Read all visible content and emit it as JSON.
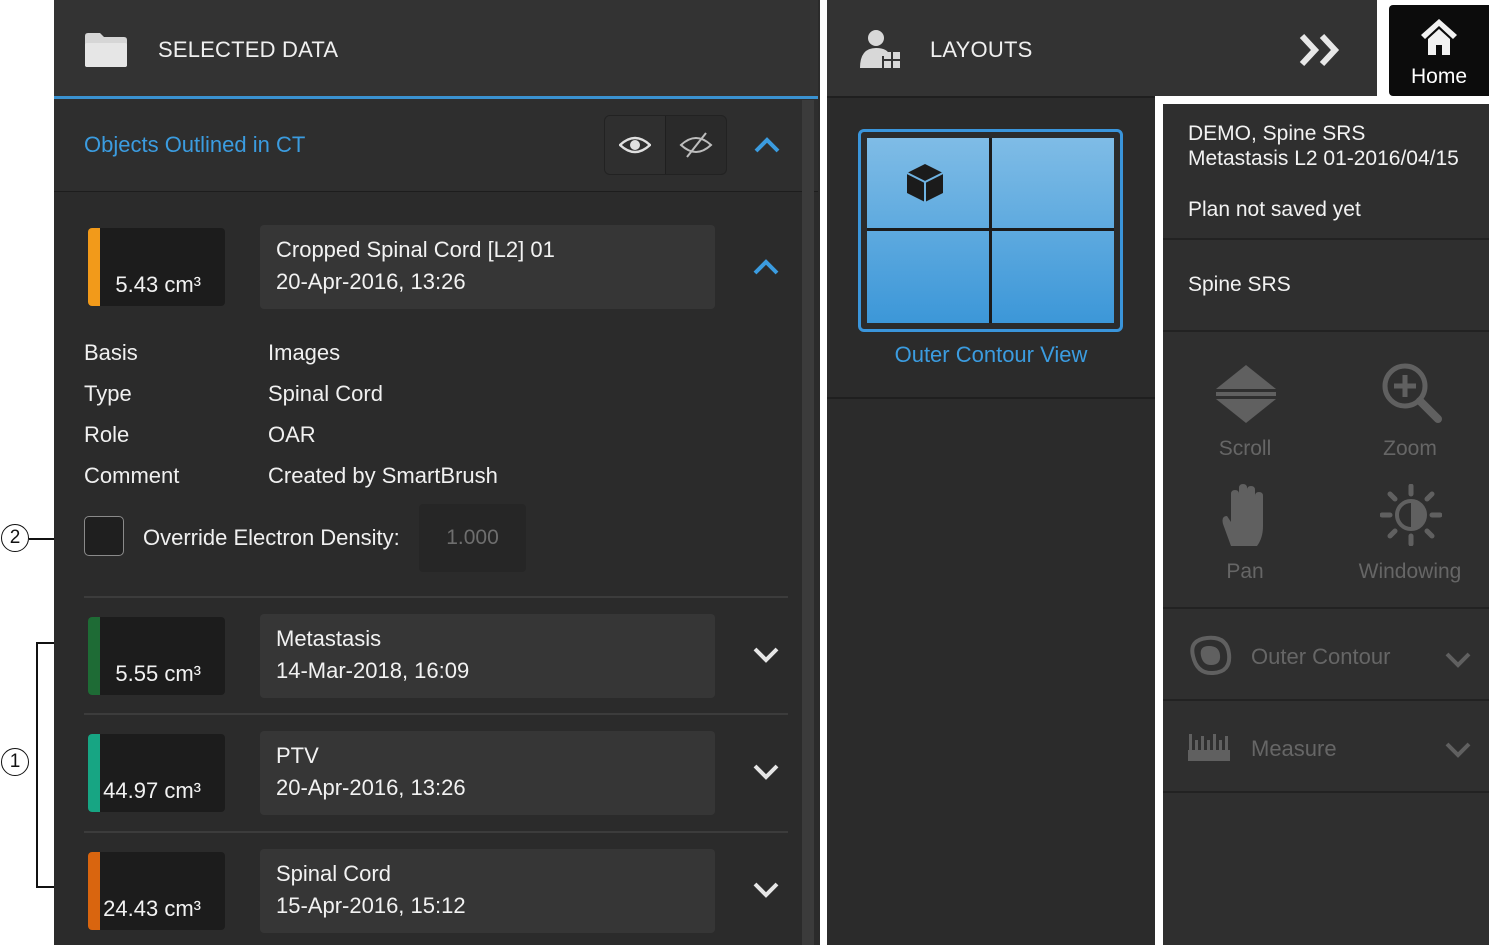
{
  "callouts": {
    "two": "2",
    "one": "1"
  },
  "selected_data": {
    "header_title": "SELECTED DATA",
    "section_title": "Objects Outlined in CT",
    "expanded_object": {
      "volume": "5.43 cm³",
      "color": "#f29a1a",
      "name": "Cropped Spinal Cord [L2] 01",
      "date": "20-Apr-2016, 13:26",
      "properties": [
        {
          "label": "Basis",
          "value": "Images"
        },
        {
          "label": "Type",
          "value": "Spinal Cord"
        },
        {
          "label": "Role",
          "value": "OAR"
        },
        {
          "label": "Comment",
          "value": "Created by SmartBrush"
        }
      ],
      "override_label": "Override Electron Density:",
      "override_value": "1.000"
    },
    "objects": [
      {
        "volume": "5.55 cm³",
        "color": "#1e6b35",
        "name": "Metastasis",
        "date": "14-Mar-2018, 16:09"
      },
      {
        "volume": "44.97 cm³",
        "color": "#17a583",
        "name": "PTV",
        "date": "20-Apr-2016, 13:26"
      },
      {
        "volume": "24.43 cm³",
        "color": "#d9650f",
        "name": "Spinal Cord",
        "date": "15-Apr-2016, 15:12"
      }
    ]
  },
  "layouts": {
    "header_title": "LAYOUTS",
    "current_layout": "Outer Contour View"
  },
  "home": {
    "label": "Home"
  },
  "patient": {
    "name": "DEMO, Spine SRS",
    "plan": "Metastasis L2 01-2016/04/15",
    "status": "Plan not saved yet",
    "indication": "Spine SRS"
  },
  "tools": {
    "scroll": "Scroll",
    "zoom": "Zoom",
    "pan": "Pan",
    "windowing": "Windowing"
  },
  "accordions": {
    "outer_contour": "Outer Contour",
    "measure": "Measure"
  },
  "colors": {
    "accent": "#3a92d1",
    "panel": "#2b2b2b"
  }
}
